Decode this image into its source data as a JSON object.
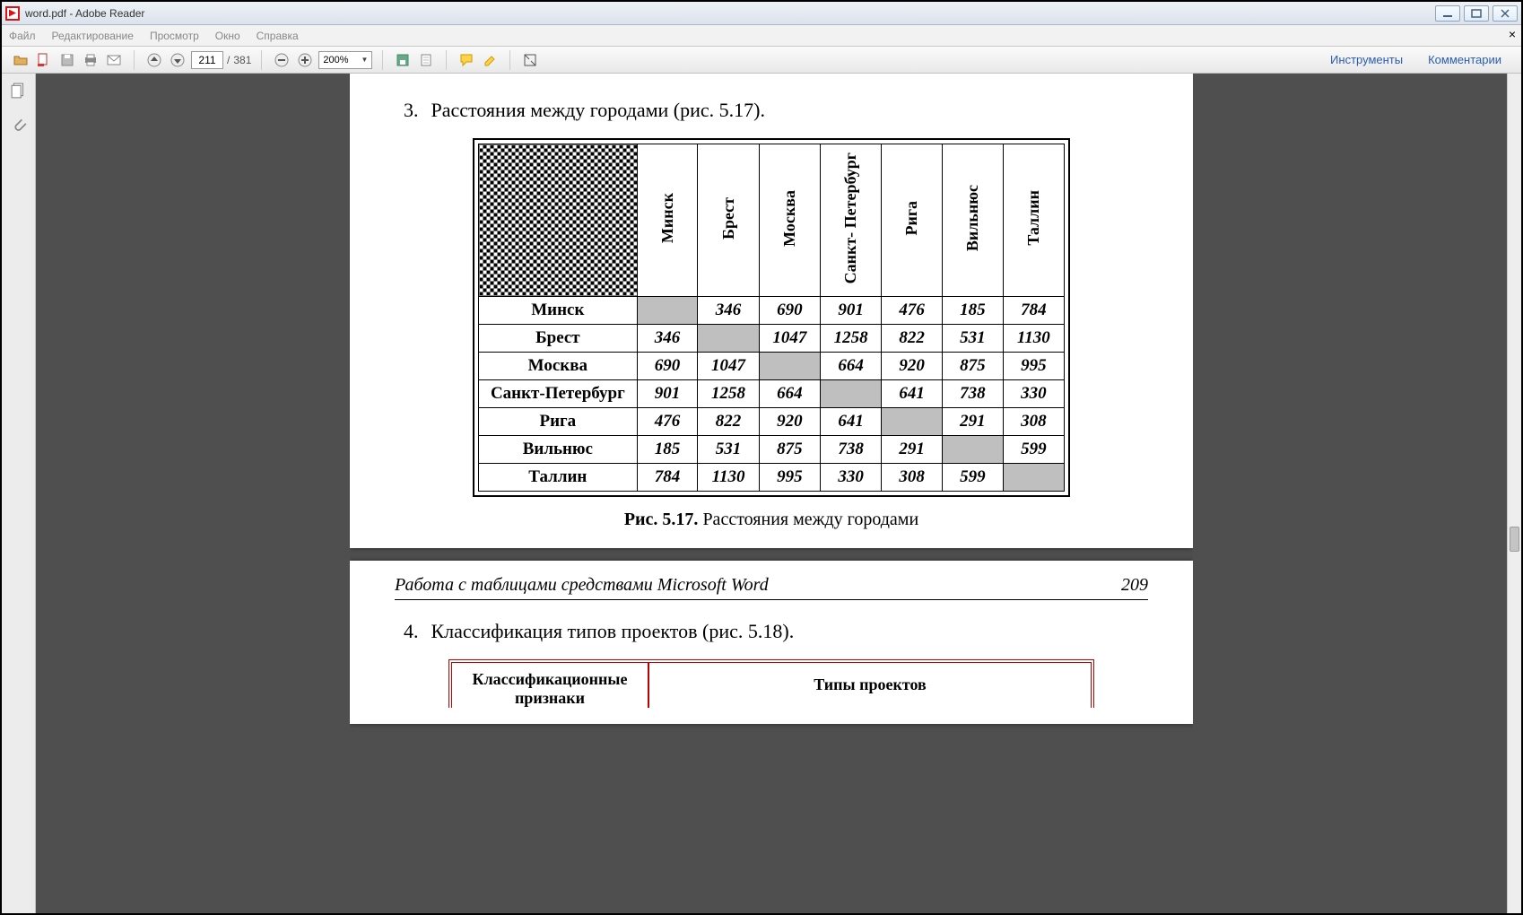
{
  "window": {
    "title": "word.pdf - Adobe Reader"
  },
  "menubar": {
    "items": [
      "Файл",
      "Редактирование",
      "Просмотр",
      "Окно",
      "Справка"
    ]
  },
  "toolbar": {
    "page_current": "211",
    "page_total": "381",
    "page_sep": "/",
    "zoom": "200%",
    "tools_label": "Инструменты",
    "comments_label": "Комментарии"
  },
  "doc": {
    "item3": {
      "num": "3.",
      "text": "Расстояния между городами (рис. 5.17)."
    },
    "dist_table": {
      "cities": [
        "Минск",
        "Брест",
        "Москва",
        "Санкт-Петербург",
        "Рига",
        "Вильнюс",
        "Таллин"
      ],
      "col_headers": [
        "Минск",
        "Брест",
        "Москва",
        "Санкт-\nПетербург",
        "Рига",
        "Вильнюс",
        "Таллин"
      ],
      "matrix": [
        [
          "",
          "346",
          "690",
          "901",
          "476",
          "185",
          "784"
        ],
        [
          "346",
          "",
          "1047",
          "1258",
          "822",
          "531",
          "1130"
        ],
        [
          "690",
          "1047",
          "",
          "664",
          "920",
          "875",
          "995"
        ],
        [
          "901",
          "1258",
          "664",
          "",
          "641",
          "738",
          "330"
        ],
        [
          "476",
          "822",
          "920",
          "641",
          "",
          "291",
          "308"
        ],
        [
          "185",
          "531",
          "875",
          "738",
          "291",
          "",
          "599"
        ],
        [
          "784",
          "1130",
          "995",
          "330",
          "308",
          "599",
          ""
        ]
      ]
    },
    "caption": {
      "label": "Рис. 5.17.",
      "text": " Расстояния между городами"
    },
    "runhead": {
      "left": "Работа с таблицами средствами Microsoft Word",
      "right": "209"
    },
    "item4": {
      "num": "4.",
      "text": "Классификация типов проектов (рис. 5.18)."
    },
    "class_table": {
      "left": "Классификационные признаки",
      "right": "Типы проектов"
    }
  }
}
